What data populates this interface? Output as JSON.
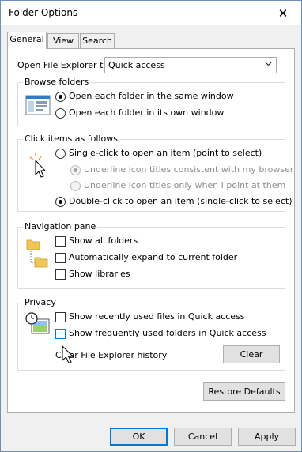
{
  "window": {
    "title": "Folder Options"
  },
  "tabs": [
    {
      "label": "General",
      "active": true
    },
    {
      "label": "View",
      "active": false
    },
    {
      "label": "Search",
      "active": false
    }
  ],
  "open_explorer": {
    "label": "Open File Explorer to:",
    "value": "Quick access"
  },
  "browse_folders": {
    "title": "Browse folders",
    "options": [
      {
        "label": "Open each folder in the same window",
        "checked": true
      },
      {
        "label": "Open each folder in its own window",
        "checked": false
      }
    ]
  },
  "click_items": {
    "title": "Click items as follows",
    "single_click": "Single-click to open an item (point to select)",
    "underline_consistent": "Underline icon titles consistent with my browser",
    "underline_point": "Underline icon titles only when I point at them",
    "double_click": "Double-click to open an item (single-click to select)"
  },
  "navigation_pane": {
    "title": "Navigation pane",
    "show_all_folders": "Show all folders",
    "auto_expand": "Automatically expand to current folder",
    "show_libraries": "Show libraries"
  },
  "privacy": {
    "title": "Privacy",
    "recent_files": "Show recently used files in Quick access",
    "frequent_folders": "Show frequently used folders in Quick access",
    "clear_label": "Clear File Explorer history",
    "clear_button": "Clear"
  },
  "buttons": {
    "restore_defaults": "Restore Defaults",
    "ok": "OK",
    "cancel": "Cancel",
    "apply": "Apply"
  },
  "colors": {
    "accent": "#0078d7",
    "window_border": "#6d8fb8",
    "dialog_bg": "#f0f0f0",
    "button_bg": "#e1e1e1"
  }
}
